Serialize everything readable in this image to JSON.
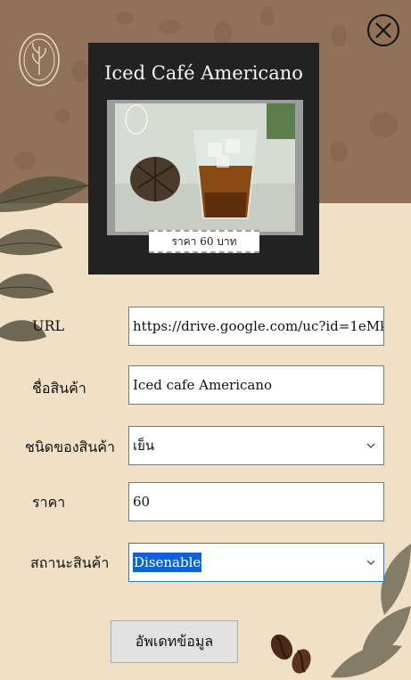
{
  "card": {
    "title": "Iced Café Americano",
    "price_tag": "ราคา 60 บาท"
  },
  "form": {
    "url_label": "URL",
    "url_value": "https://drive.google.com/uc?id=1eMk",
    "name_label": "ชื่อสินค้า",
    "name_value": "Iced cafe Americano",
    "type_label": "ชนิดของสินค้า",
    "type_value": "เย็น",
    "price_label": "ราคา",
    "price_value": "60",
    "status_label": "สถานะสินค้า",
    "status_value": "Disenable"
  },
  "buttons": {
    "update_label": "อัพเดทข้อมูล"
  },
  "icons": {
    "close": "close-icon",
    "logo": "brand-logo-icon",
    "dropdown": "chevron-down-icon"
  },
  "colors": {
    "header_brown": "#8f7257",
    "body_cream": "#efe0c6",
    "selection_blue": "#0a64d8"
  }
}
